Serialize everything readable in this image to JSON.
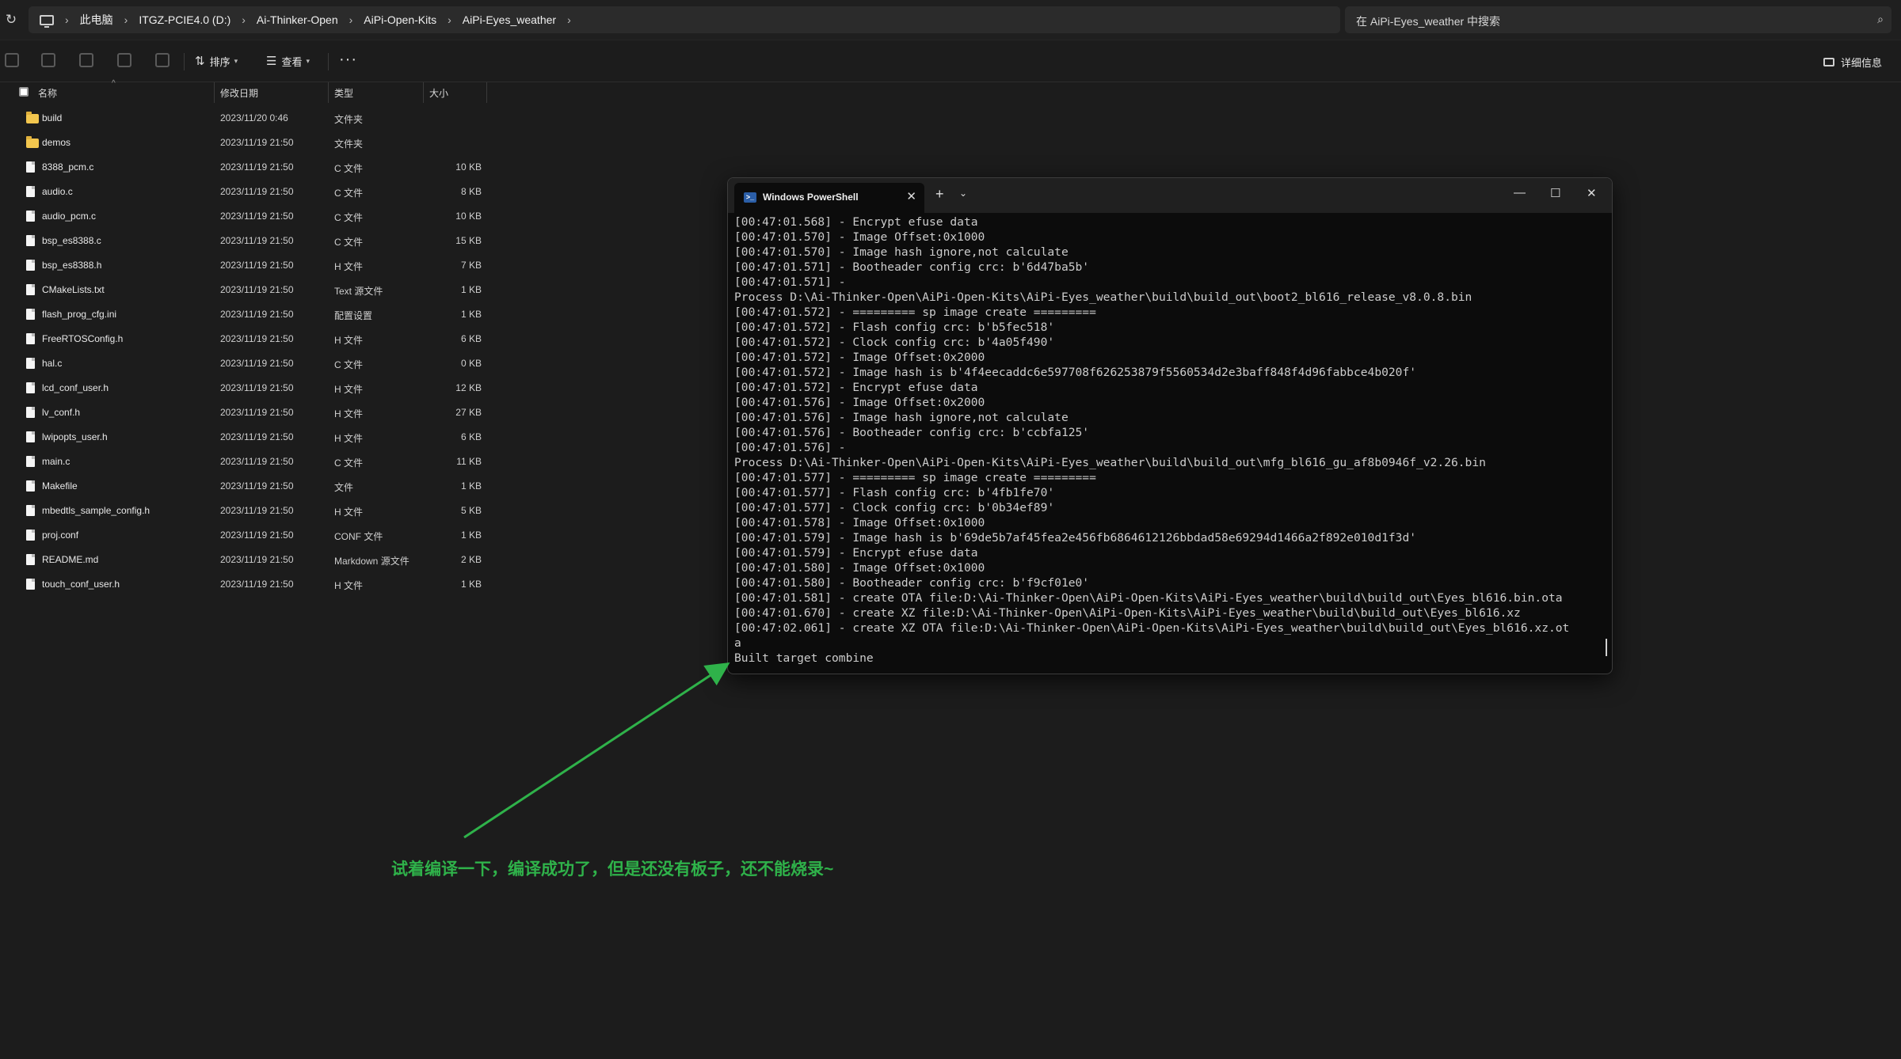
{
  "address_bar": {
    "crumbs": [
      "此电脑",
      "ITGZ-PCIE4.0 (D:)",
      "Ai-Thinker-Open",
      "AiPi-Open-Kits",
      "AiPi-Eyes_weather"
    ],
    "search_placeholder": "在 AiPi-Eyes_weather 中搜索"
  },
  "toolbar": {
    "sort_label": "排序",
    "view_label": "查看",
    "more_label": "···",
    "details_label": "详细信息"
  },
  "columns": {
    "name": "名称",
    "date": "修改日期",
    "type": "类型",
    "size": "大小"
  },
  "files": [
    {
      "name": "build",
      "date": "2023/11/20 0:46",
      "type": "文件夹",
      "size": "",
      "kind": "folder"
    },
    {
      "name": "demos",
      "date": "2023/11/19 21:50",
      "type": "文件夹",
      "size": "",
      "kind": "folder"
    },
    {
      "name": "8388_pcm.c",
      "date": "2023/11/19 21:50",
      "type": "C 文件",
      "size": "10 KB",
      "kind": "file"
    },
    {
      "name": "audio.c",
      "date": "2023/11/19 21:50",
      "type": "C 文件",
      "size": "8 KB",
      "kind": "file"
    },
    {
      "name": "audio_pcm.c",
      "date": "2023/11/19 21:50",
      "type": "C 文件",
      "size": "10 KB",
      "kind": "file"
    },
    {
      "name": "bsp_es8388.c",
      "date": "2023/11/19 21:50",
      "type": "C 文件",
      "size": "15 KB",
      "kind": "file"
    },
    {
      "name": "bsp_es8388.h",
      "date": "2023/11/19 21:50",
      "type": "H 文件",
      "size": "7 KB",
      "kind": "file"
    },
    {
      "name": "CMakeLists.txt",
      "date": "2023/11/19 21:50",
      "type": "Text 源文件",
      "size": "1 KB",
      "kind": "file"
    },
    {
      "name": "flash_prog_cfg.ini",
      "date": "2023/11/19 21:50",
      "type": "配置设置",
      "size": "1 KB",
      "kind": "file"
    },
    {
      "name": "FreeRTOSConfig.h",
      "date": "2023/11/19 21:50",
      "type": "H 文件",
      "size": "6 KB",
      "kind": "file"
    },
    {
      "name": "hal.c",
      "date": "2023/11/19 21:50",
      "type": "C 文件",
      "size": "0 KB",
      "kind": "file"
    },
    {
      "name": "lcd_conf_user.h",
      "date": "2023/11/19 21:50",
      "type": "H 文件",
      "size": "12 KB",
      "kind": "file"
    },
    {
      "name": "lv_conf.h",
      "date": "2023/11/19 21:50",
      "type": "H 文件",
      "size": "27 KB",
      "kind": "file"
    },
    {
      "name": "lwipopts_user.h",
      "date": "2023/11/19 21:50",
      "type": "H 文件",
      "size": "6 KB",
      "kind": "file"
    },
    {
      "name": "main.c",
      "date": "2023/11/19 21:50",
      "type": "C 文件",
      "size": "11 KB",
      "kind": "file"
    },
    {
      "name": "Makefile",
      "date": "2023/11/19 21:50",
      "type": "文件",
      "size": "1 KB",
      "kind": "file"
    },
    {
      "name": "mbedtls_sample_config.h",
      "date": "2023/11/19 21:50",
      "type": "H 文件",
      "size": "5 KB",
      "kind": "file"
    },
    {
      "name": "proj.conf",
      "date": "2023/11/19 21:50",
      "type": "CONF 文件",
      "size": "1 KB",
      "kind": "file"
    },
    {
      "name": "README.md",
      "date": "2023/11/19 21:50",
      "type": "Markdown 源文件",
      "size": "2 KB",
      "kind": "file"
    },
    {
      "name": "touch_conf_user.h",
      "date": "2023/11/19 21:50",
      "type": "H 文件",
      "size": "1 KB",
      "kind": "file"
    }
  ],
  "terminal": {
    "tab_title": "Windows PowerShell",
    "lines": [
      "[00:47:01.568] - Encrypt efuse data",
      "[00:47:01.570] - Image Offset:0x1000",
      "[00:47:01.570] - Image hash ignore,not calculate",
      "[00:47:01.571] - Bootheader config crc: b'6d47ba5b'",
      "[00:47:01.571] -",
      "Process D:\\Ai-Thinker-Open\\AiPi-Open-Kits\\AiPi-Eyes_weather\\build\\build_out\\boot2_bl616_release_v8.0.8.bin",
      "[00:47:01.572] - ========= sp image create =========",
      "[00:47:01.572] - Flash config crc: b'b5fec518'",
      "[00:47:01.572] - Clock config crc: b'4a05f490'",
      "[00:47:01.572] - Image Offset:0x2000",
      "[00:47:01.572] - Image hash is b'4f4eecaddc6e597708f626253879f5560534d2e3baff848f4d96fabbce4b020f'",
      "[00:47:01.572] - Encrypt efuse data",
      "[00:47:01.576] - Image Offset:0x2000",
      "[00:47:01.576] - Image hash ignore,not calculate",
      "[00:47:01.576] - Bootheader config crc: b'ccbfa125'",
      "[00:47:01.576] -",
      "Process D:\\Ai-Thinker-Open\\AiPi-Open-Kits\\AiPi-Eyes_weather\\build\\build_out\\mfg_bl616_gu_af8b0946f_v2.26.bin",
      "[00:47:01.577] - ========= sp image create =========",
      "[00:47:01.577] - Flash config crc: b'4fb1fe70'",
      "[00:47:01.577] - Clock config crc: b'0b34ef89'",
      "[00:47:01.578] - Image Offset:0x1000",
      "[00:47:01.579] - Image hash is b'69de5b7af45fea2e456fb6864612126bbdad58e69294d1466a2f892e010d1f3d'",
      "[00:47:01.579] - Encrypt efuse data",
      "[00:47:01.580] - Image Offset:0x1000",
      "[00:47:01.580] - Bootheader config crc: b'f9cf01e0'",
      "[00:47:01.581] - create OTA file:D:\\Ai-Thinker-Open\\AiPi-Open-Kits\\AiPi-Eyes_weather\\build\\build_out\\Eyes_bl616.bin.ota",
      "[00:47:01.670] - create XZ file:D:\\Ai-Thinker-Open\\AiPi-Open-Kits\\AiPi-Eyes_weather\\build\\build_out\\Eyes_bl616.xz",
      "[00:47:02.061] - create XZ OTA file:D:\\Ai-Thinker-Open\\AiPi-Open-Kits\\AiPi-Eyes_weather\\build\\build_out\\Eyes_bl616.xz.ot",
      "a",
      "Built target combine"
    ]
  },
  "annotation": {
    "text": "试着编译一下，编译成功了，但是还没有板子，还不能烧录~",
    "color": "#2fb24a"
  },
  "icons": {
    "refresh": "refresh-icon",
    "computer": "computer-icon",
    "search": "search-icon",
    "folder": "folder-icon",
    "file": "file-icon",
    "powershell": "powershell-icon"
  }
}
